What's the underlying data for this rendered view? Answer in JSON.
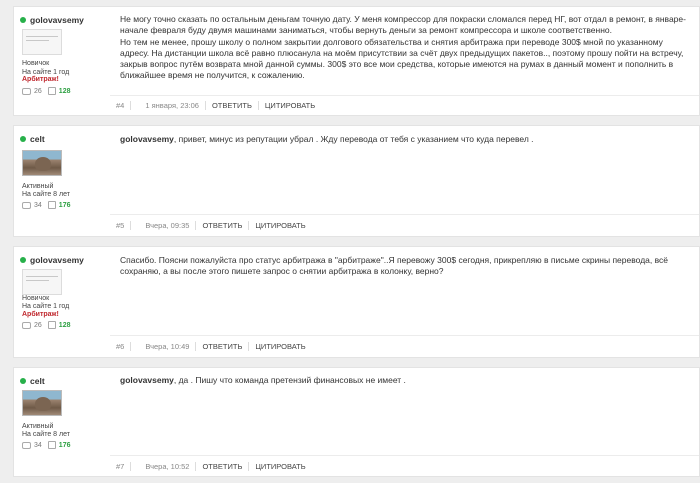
{
  "posts": [
    {
      "author": "golovavsemy",
      "rank": "Новичок",
      "member_since": "На сайте 1 год",
      "badge": "Арбитраж!",
      "comments": "26",
      "likes": "128",
      "num": "#4",
      "date": "1 января, 23:06",
      "reply": "ОТВЕТИТЬ",
      "quote": "ЦИТИРОВАТЬ",
      "text": "Не могу точно сказать по остальным деньгам точную дату. У меня компрессор для покраски сломался перед НГ, вот отдал в ремонт, в январе-начале февраля буду двумя машинами заниматься, чтобы вернуть деньги за ремонт компрессора и школе соответственно.\nНо тем не менее, прошу школу о полном закрытии долгового обязательства и снятия арбитража при переводе 300$ мной по указанному адресу. На дистанции школа всё равно плюсанула на моём присутствии за счёт двух предыдущих пакетов.., поэтому прошу пойти на встречу, закрыв вопрос путём возврата мной данной суммы. 300$ это все мои средства, которые имеются на румах в данный момент и пополнить в ближайшее время не получится, к сожалению."
    },
    {
      "author": "celt",
      "rank": "Активный",
      "member_since": "На сайте 8 лет",
      "comments": "34",
      "likes": "176",
      "num": "#5",
      "date": "Вчера, 09:35",
      "reply": "ОТВЕТИТЬ",
      "quote": "ЦИТИРОВАТЬ",
      "mention": "golovavsemy",
      "text": ", привет, минус из репутации убрал . Жду перевода от тебя с указанием что куда перевел ."
    },
    {
      "author": "golovavsemy",
      "rank": "Новичок",
      "member_since": "На сайте 1 год",
      "badge": "Арбитраж!",
      "comments": "26",
      "likes": "128",
      "num": "#6",
      "date": "Вчера, 10:49",
      "reply": "ОТВЕТИТЬ",
      "quote": "ЦИТИРОВАТЬ",
      "text": "Спасибо. Поясни пожалуйста про статус арбитража в \"арбитраже\"..Я перевожу 300$ сегодня, прикрепляю в письме скрины перевода, всё сохраняю, а вы после этого пишете запрос о снятии арбитража в колонку, верно?"
    },
    {
      "author": "celt",
      "rank": "Активный",
      "member_since": "На сайте 8 лет",
      "comments": "34",
      "likes": "176",
      "num": "#7",
      "date": "Вчера, 10:52",
      "reply": "ОТВЕТИТЬ",
      "quote": "ЦИТИРОВАТЬ",
      "mention": "golovavsemy",
      "text": ", да . Пишу что команда претензий финансовых не имеет ."
    }
  ]
}
